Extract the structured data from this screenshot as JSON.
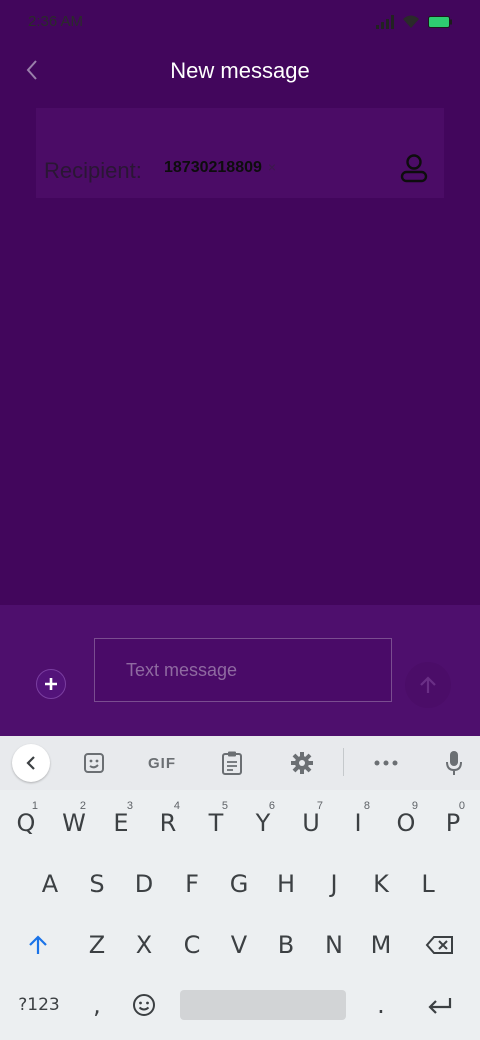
{
  "status_bar": {
    "time": "2:36 AM"
  },
  "header": {
    "title": "New message"
  },
  "recipient": {
    "label": "Recipient:",
    "chip": "18730218809",
    "chip_remove": "×"
  },
  "compose": {
    "placeholder": "Text message"
  },
  "keyboard": {
    "toolbar": [
      "back",
      "sticker",
      "GIF",
      "clipboard",
      "settings",
      "more",
      "mic"
    ],
    "gif_label": "GIF",
    "row1": [
      {
        "k": "Q",
        "h": "1"
      },
      {
        "k": "W",
        "h": "2"
      },
      {
        "k": "E",
        "h": "3"
      },
      {
        "k": "R",
        "h": "4"
      },
      {
        "k": "T",
        "h": "5"
      },
      {
        "k": "Y",
        "h": "6"
      },
      {
        "k": "U",
        "h": "7"
      },
      {
        "k": "I",
        "h": "8"
      },
      {
        "k": "O",
        "h": "9"
      },
      {
        "k": "P",
        "h": "0"
      }
    ],
    "row2": [
      "A",
      "S",
      "D",
      "F",
      "G",
      "H",
      "J",
      "K",
      "L"
    ],
    "row3": [
      "Z",
      "X",
      "C",
      "V",
      "B",
      "N",
      "M"
    ],
    "symbols_label": "?123",
    "comma": ",",
    "period": "."
  },
  "colors": {
    "background": "#42065c",
    "compose_bg": "#4e0f6d",
    "keyboard_bg": "#eceff1",
    "accent": "#1a73e8"
  }
}
